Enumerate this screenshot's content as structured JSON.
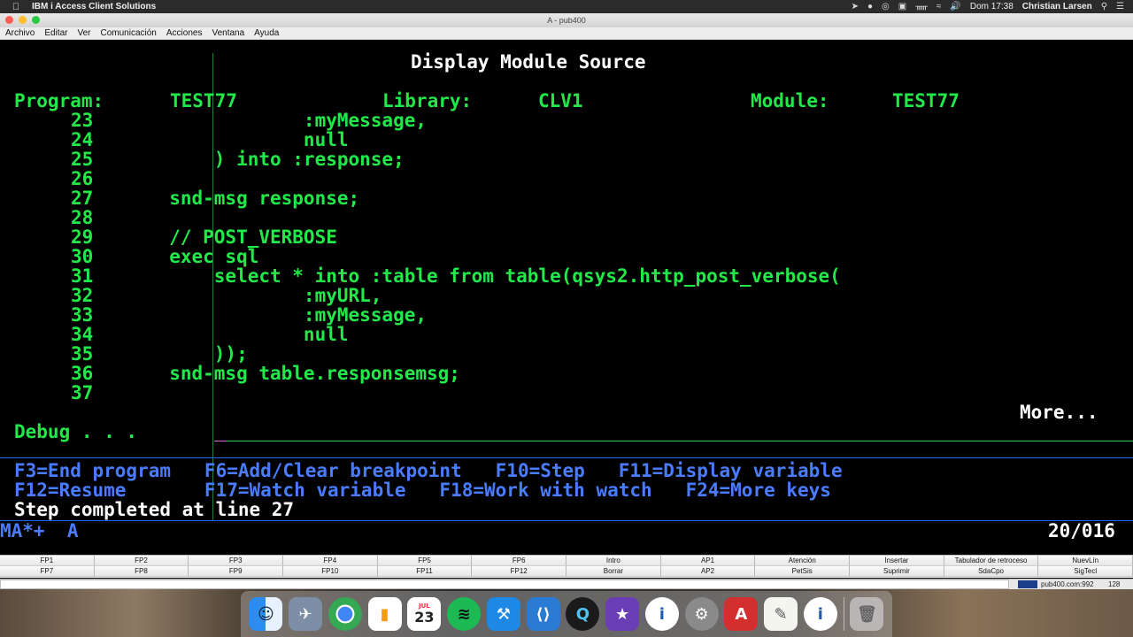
{
  "mac_menubar": {
    "app_name": "IBM i Access Client Solutions",
    "clock": "Dom 17:38",
    "user": "Christian Larsen"
  },
  "window": {
    "title": "A - pub400"
  },
  "app_menu": [
    "Archivo",
    "Editar",
    "Ver",
    "Comunicación",
    "Acciones",
    "Ventana",
    "Ayuda"
  ],
  "terminal": {
    "screen_title": "Display Module Source",
    "program_label": "Program:",
    "program_value": "TEST77",
    "library_label": "Library:",
    "library_value": "CLV1",
    "module_label": "Module:",
    "module_value": "TEST77",
    "source_lines": [
      {
        "num": "23",
        "code": "                 :myMessage,"
      },
      {
        "num": "24",
        "code": "                 null"
      },
      {
        "num": "25",
        "code": "         ) into :response;"
      },
      {
        "num": "26",
        "code": ""
      },
      {
        "num": "27",
        "code": "     snd-msg response;"
      },
      {
        "num": "28",
        "code": ""
      },
      {
        "num": "29",
        "code": "     // POST_VERBOSE"
      },
      {
        "num": "30",
        "code": "     exec sql"
      },
      {
        "num": "31",
        "code": "         select * into :table from table(qsys2.http_post_verbose("
      },
      {
        "num": "32",
        "code": "                 :myURL,"
      },
      {
        "num": "33",
        "code": "                 :myMessage,"
      },
      {
        "num": "34",
        "code": "                 null"
      },
      {
        "num": "35",
        "code": "         ));"
      },
      {
        "num": "36",
        "code": "     snd-msg table.responsemsg;"
      },
      {
        "num": "37",
        "code": ""
      }
    ],
    "more": "More...",
    "debug_prompt": "Debug . . .",
    "fkeys_line1": "F3=End program   F6=Add/Clear breakpoint   F10=Step   F11=Display variable",
    "fkeys_line2": "F12=Resume       F17=Watch variable   F18=Work with watch   F24=More keys",
    "message": "Step completed at line 27",
    "oia_left": "MA*+  A",
    "oia_right": "20/016"
  },
  "fkey_bar": {
    "row1": [
      "FP1",
      "FP2",
      "FP3",
      "FP4",
      "FP5",
      "FP6",
      "Intro",
      "AP1",
      "Atención",
      "Insertar",
      "Tabulador de retroceso",
      "NuevLín"
    ],
    "row2": [
      "FP7",
      "FP8",
      "FP9",
      "FP10",
      "FP11",
      "FP12",
      "Borrar",
      "AP2",
      "PetSis",
      "Suprimir",
      "SdaCpo",
      "SigTecl"
    ]
  },
  "status_bar": {
    "host": "pub400.com:992",
    "count": "128"
  },
  "dock": {
    "calendar_month": "JUL",
    "calendar_day": "23"
  },
  "colors": {
    "terminal_green": "#22e94a",
    "terminal_white": "#ffffff",
    "terminal_blue": "#2a62ff"
  }
}
